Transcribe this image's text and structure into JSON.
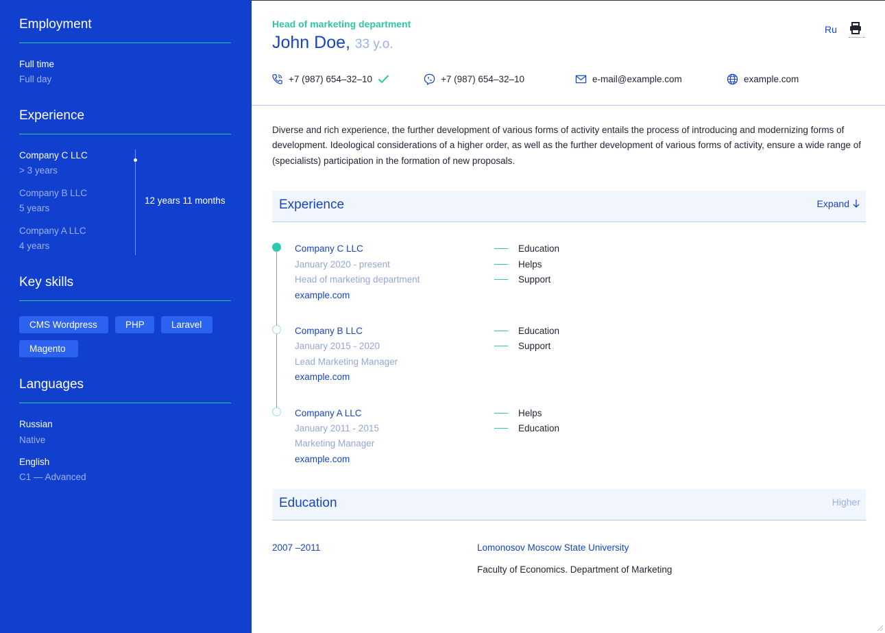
{
  "sidebar": {
    "employment": {
      "heading": "Employment",
      "type": "Full time",
      "schedule": "Full day"
    },
    "experience": {
      "heading": "Experience",
      "total": "12 years 11 months",
      "items": [
        {
          "company": "Company C LLC",
          "duration": "> 3 years"
        },
        {
          "company": "Company B LLC",
          "duration": "5 years"
        },
        {
          "company": "Company A LLC",
          "duration": "4 years"
        }
      ]
    },
    "skills": {
      "heading": "Key skills",
      "items": [
        "CMS Wordpress",
        "PHP",
        "Laravel",
        "Magento"
      ]
    },
    "languages": {
      "heading": "Languages",
      "items": [
        {
          "name": "Russian",
          "level": "Native"
        },
        {
          "name": "English",
          "level": "C1 — Advanced"
        }
      ]
    }
  },
  "header": {
    "position": "Head of marketing department",
    "name": "John Doe,",
    "age": "33 y.o.",
    "language_switch": "Ru",
    "print_icon": "printer-icon",
    "contacts": [
      {
        "icon": "phone-icon",
        "value": "+7 (987) 654–32–10",
        "verified": true
      },
      {
        "icon": "viber-icon",
        "value": "+7 (987) 654–32–10"
      },
      {
        "icon": "mail-icon",
        "value": "e-mail@example.com"
      },
      {
        "icon": "globe-icon",
        "value": "example.com"
      }
    ]
  },
  "summary": "Diverse and rich experience, the further development of various forms of activity entails the process of introducing and modernizing forms of development. Ideological considerations of a higher order, as well as the further development of various forms of activity, ensure a wide range of (specialists) participation in the formation of new proposals.",
  "experience_section": {
    "title": "Experience",
    "expand_label": "Expand",
    "jobs": [
      {
        "company": "Company C LLC",
        "period": "January 2020 - present",
        "role": "Head of marketing department",
        "link": "example.com",
        "responsibilities": [
          "Education",
          "Helps",
          "Support"
        ]
      },
      {
        "company": "Company B LLC",
        "period": "January 2015 - 2020",
        "role": "Lead Marketing Manager",
        "link": "example.com",
        "responsibilities": [
          "Education",
          "Support"
        ]
      },
      {
        "company": "Company A LLC",
        "period": "January 2011 - 2015",
        "role": "Marketing Manager",
        "link": "example.com",
        "responsibilities": [
          "Helps",
          "Education"
        ]
      }
    ]
  },
  "education_section": {
    "title": "Education",
    "level": "Higher",
    "entries": [
      {
        "years": "2007 –2011",
        "institution": "Lomonosov Moscow State University",
        "faculty": "Faculty of Economics. Department of Marketing"
      }
    ]
  },
  "colors": {
    "sidebar_bg": "#1140cf",
    "accent_teal": "#2ec7b3",
    "brand_blue": "#1645c4",
    "skill_chip": "#2b63f0"
  }
}
